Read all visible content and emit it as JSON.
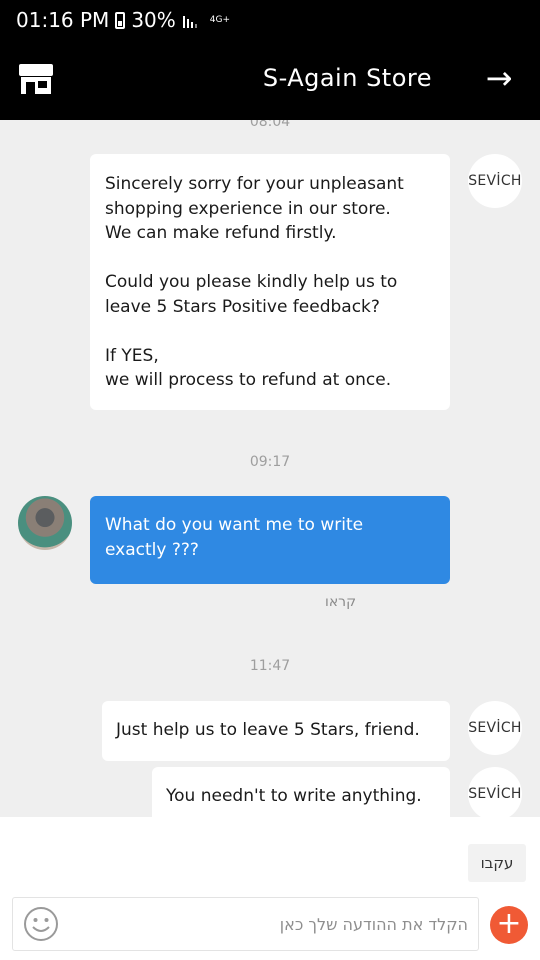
{
  "status_bar": {
    "time": "01:16 PM",
    "battery": "30%",
    "signal": "4G+"
  },
  "header": {
    "title": "S-Again Store",
    "store_icon": "store-icon",
    "forward_icon": "arrow-right-icon",
    "forward_glyph": "→"
  },
  "chat": {
    "ts_top_partial": "08:04",
    "msg1": "Sincerely sorry for your unpleasant\nshopping experience in our store.\nWe can make refund firstly.\n\nCould you please kindly help us to\nleave 5 Stars Positive feedback?\n\nIf YES,\nwe will process to refund at once.",
    "ts2": "09:17",
    "msg2": "What do you want me to write\nexactly ???",
    "read_status": "קראו",
    "ts3": "11:47",
    "msg3": "Just help us to leave 5 Stars, friend.",
    "msg4": "You needn't to write anything.",
    "seller_avatar_label": "SEVİCH"
  },
  "bottom": {
    "follow_label": "עקבו",
    "input_placeholder": "הקלד את ההודעה שלך כאן",
    "plus_glyph": "+"
  },
  "colors": {
    "header_bg": "#000000",
    "my_bubble": "#2f89e3",
    "plus_button": "#f05a35",
    "chat_bg": "#efefef"
  }
}
